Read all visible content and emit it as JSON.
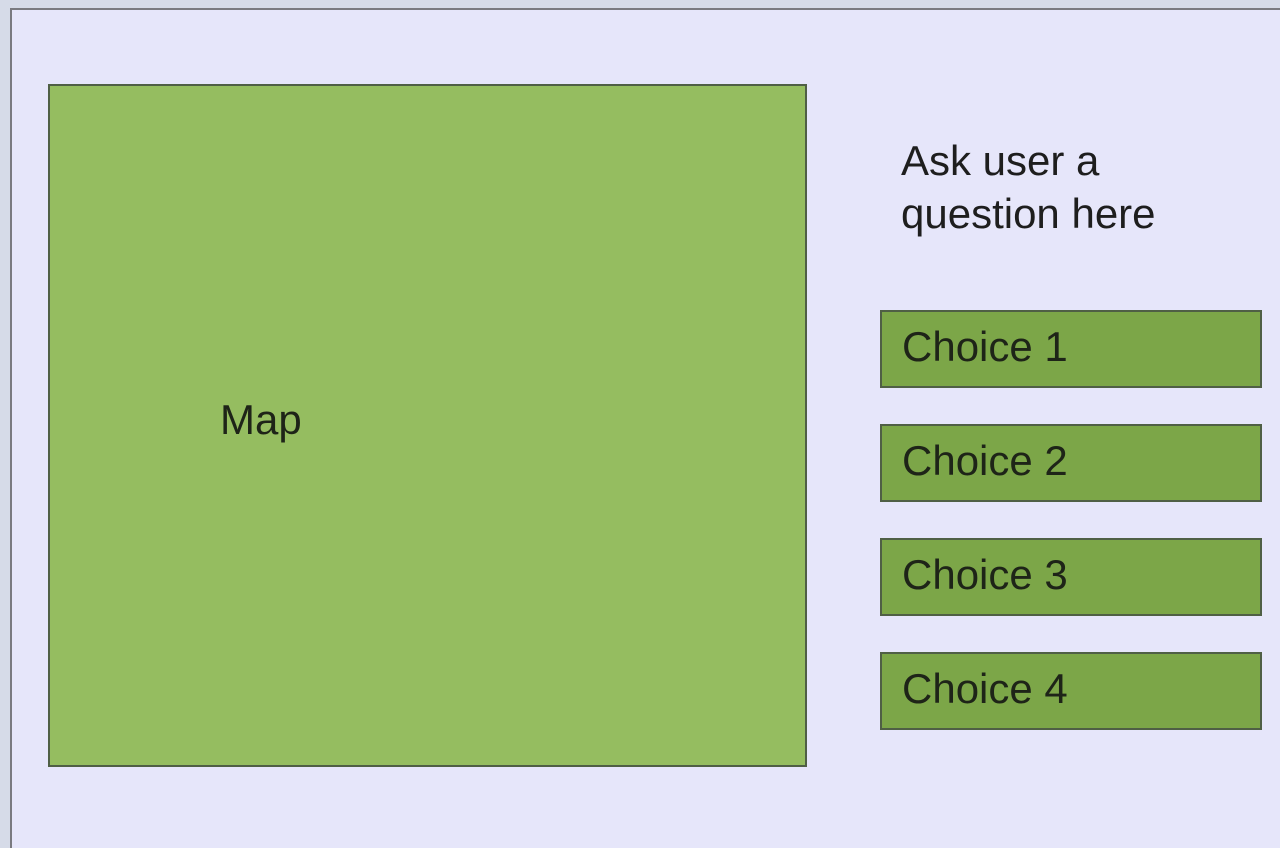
{
  "map": {
    "label": "Map"
  },
  "question": {
    "text": "Ask user a question here"
  },
  "choices": [
    {
      "label": "Choice 1"
    },
    {
      "label": "Choice 2"
    },
    {
      "label": "Choice 3"
    },
    {
      "label": "Choice 4"
    }
  ],
  "colors": {
    "background": "#e6e6fa",
    "map": "#95bd60",
    "choice": "#7ca648",
    "border": "#4f5f45"
  }
}
